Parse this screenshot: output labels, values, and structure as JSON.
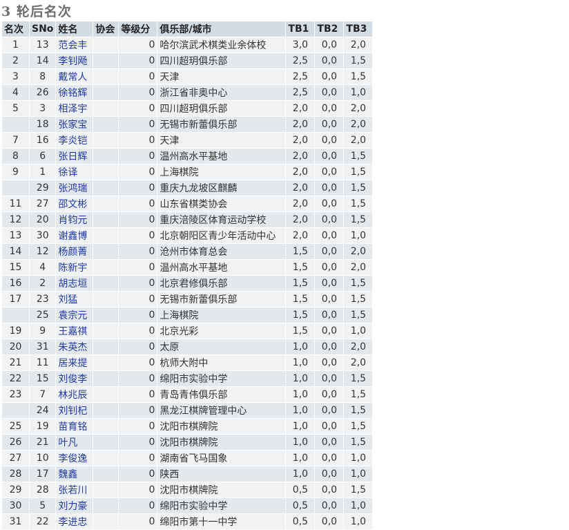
{
  "title": "3 轮后名次",
  "headers": {
    "rank": "名次",
    "sno": "SNo",
    "name": "姓名",
    "fed": "协会",
    "rating": "等级分",
    "club": "俱乐部/城市",
    "tb1": "TB1",
    "tb2": "TB2",
    "tb3": "TB3"
  },
  "rows": [
    {
      "rank": "1",
      "sno": "13",
      "name": "范会丰",
      "fed": "",
      "rating": "0",
      "club": "哈尔滨武术棋类业余体校",
      "tb1": "3,0",
      "tb2": "0,0",
      "tb3": "2,0"
    },
    {
      "rank": "2",
      "sno": "14",
      "name": "李钊飏",
      "fed": "",
      "rating": "0",
      "club": "四川超玥俱乐部",
      "tb1": "2,5",
      "tb2": "0,0",
      "tb3": "1,5"
    },
    {
      "rank": "3",
      "sno": "8",
      "name": "戴常人",
      "fed": "",
      "rating": "0",
      "club": "天津",
      "tb1": "2,5",
      "tb2": "0,0",
      "tb3": "1,5"
    },
    {
      "rank": "4",
      "sno": "26",
      "name": "徐铭辉",
      "fed": "",
      "rating": "0",
      "club": "浙江省非奥中心",
      "tb1": "2,5",
      "tb2": "0,0",
      "tb3": "1,0"
    },
    {
      "rank": "5",
      "sno": "3",
      "name": "相泽宇",
      "fed": "",
      "rating": "0",
      "club": "四川超玥俱乐部",
      "tb1": "2,0",
      "tb2": "0,0",
      "tb3": "2,0"
    },
    {
      "rank": "",
      "sno": "18",
      "name": "张家宝",
      "fed": "",
      "rating": "0",
      "club": "无锡市新蕾俱乐部",
      "tb1": "2,0",
      "tb2": "0,0",
      "tb3": "2,0"
    },
    {
      "rank": "7",
      "sno": "16",
      "name": "李炎铠",
      "fed": "",
      "rating": "0",
      "club": "天津",
      "tb1": "2,0",
      "tb2": "0,0",
      "tb3": "2,0"
    },
    {
      "rank": "8",
      "sno": "6",
      "name": "张日辉",
      "fed": "",
      "rating": "0",
      "club": "温州高水平基地",
      "tb1": "2,0",
      "tb2": "0,0",
      "tb3": "1,5"
    },
    {
      "rank": "9",
      "sno": "1",
      "name": "徐译",
      "fed": "",
      "rating": "0",
      "club": "上海棋院",
      "tb1": "2,0",
      "tb2": "0,0",
      "tb3": "1,5"
    },
    {
      "rank": "",
      "sno": "29",
      "name": "张鸿瑞",
      "fed": "",
      "rating": "0",
      "club": "重庆九龙坡区麒麟",
      "tb1": "2,0",
      "tb2": "0,0",
      "tb3": "1,5"
    },
    {
      "rank": "11",
      "sno": "27",
      "name": "邵文彬",
      "fed": "",
      "rating": "0",
      "club": "山东省棋类协会",
      "tb1": "2,0",
      "tb2": "0,0",
      "tb3": "1,5"
    },
    {
      "rank": "12",
      "sno": "20",
      "name": "肖钧元",
      "fed": "",
      "rating": "0",
      "club": "重庆涪陵区体育运动学校",
      "tb1": "2,0",
      "tb2": "0,0",
      "tb3": "1,5"
    },
    {
      "rank": "13",
      "sno": "30",
      "name": "谢鑫博",
      "fed": "",
      "rating": "0",
      "club": "北京朝阳区青少年活动中心",
      "tb1": "2,0",
      "tb2": "0,0",
      "tb3": "1,0"
    },
    {
      "rank": "14",
      "sno": "12",
      "name": "杨颜菁",
      "fed": "",
      "rating": "0",
      "club": "沧州市体育总会",
      "tb1": "1,5",
      "tb2": "0,0",
      "tb3": "2,0"
    },
    {
      "rank": "15",
      "sno": "4",
      "name": "陈新宇",
      "fed": "",
      "rating": "0",
      "club": "温州高水平基地",
      "tb1": "1,5",
      "tb2": "0,0",
      "tb3": "2,0"
    },
    {
      "rank": "16",
      "sno": "2",
      "name": "胡志垣",
      "fed": "",
      "rating": "0",
      "club": "北京君修俱乐部",
      "tb1": "1,5",
      "tb2": "0,0",
      "tb3": "1,5"
    },
    {
      "rank": "17",
      "sno": "23",
      "name": "刘猛",
      "fed": "",
      "rating": "0",
      "club": "无锡市新蕾俱乐部",
      "tb1": "1,5",
      "tb2": "0,0",
      "tb3": "1,5"
    },
    {
      "rank": "",
      "sno": "25",
      "name": "袁宗元",
      "fed": "",
      "rating": "0",
      "club": "上海棋院",
      "tb1": "1,5",
      "tb2": "0,0",
      "tb3": "1,5"
    },
    {
      "rank": "19",
      "sno": "9",
      "name": "王嘉祺",
      "fed": "",
      "rating": "0",
      "club": "北京光彩",
      "tb1": "1,5",
      "tb2": "0,0",
      "tb3": "1,0"
    },
    {
      "rank": "20",
      "sno": "31",
      "name": "朱英杰",
      "fed": "",
      "rating": "0",
      "club": "太原",
      "tb1": "1,0",
      "tb2": "0,0",
      "tb3": "2,0"
    },
    {
      "rank": "21",
      "sno": "11",
      "name": "居来提",
      "fed": "",
      "rating": "0",
      "club": "杭师大附中",
      "tb1": "1,0",
      "tb2": "0,0",
      "tb3": "2,0"
    },
    {
      "rank": "22",
      "sno": "15",
      "name": "刘俊李",
      "fed": "",
      "rating": "0",
      "club": "绵阳市实验中学",
      "tb1": "1,0",
      "tb2": "0,0",
      "tb3": "1,5"
    },
    {
      "rank": "23",
      "sno": "7",
      "name": "林兆辰",
      "fed": "",
      "rating": "0",
      "club": "青岛青伟俱乐部",
      "tb1": "1,0",
      "tb2": "0,0",
      "tb3": "1,5"
    },
    {
      "rank": "",
      "sno": "24",
      "name": "刘钊杞",
      "fed": "",
      "rating": "0",
      "club": "黑龙江棋牌管理中心",
      "tb1": "1,0",
      "tb2": "0,0",
      "tb3": "1,5"
    },
    {
      "rank": "25",
      "sno": "19",
      "name": "苗育铭",
      "fed": "",
      "rating": "0",
      "club": "沈阳市棋牌院",
      "tb1": "1,0",
      "tb2": "0,0",
      "tb3": "1,5"
    },
    {
      "rank": "26",
      "sno": "21",
      "name": "叶凡",
      "fed": "",
      "rating": "0",
      "club": "沈阳市棋牌院",
      "tb1": "1,0",
      "tb2": "0,0",
      "tb3": "1,5"
    },
    {
      "rank": "27",
      "sno": "10",
      "name": "李俊逸",
      "fed": "",
      "rating": "0",
      "club": "湖南省飞马国象",
      "tb1": "1,0",
      "tb2": "0,0",
      "tb3": "1,0"
    },
    {
      "rank": "28",
      "sno": "17",
      "name": "魏鑫",
      "fed": "",
      "rating": "0",
      "club": "陕西",
      "tb1": "1,0",
      "tb2": "0,0",
      "tb3": "1,0"
    },
    {
      "rank": "29",
      "sno": "28",
      "name": "张若川",
      "fed": "",
      "rating": "0",
      "club": "沈阳市棋牌院",
      "tb1": "0,5",
      "tb2": "0,0",
      "tb3": "1,5"
    },
    {
      "rank": "30",
      "sno": "5",
      "name": "刘力豪",
      "fed": "",
      "rating": "0",
      "club": "绵阳市实验中学",
      "tb1": "0,5",
      "tb2": "0,0",
      "tb3": "1,0"
    },
    {
      "rank": "31",
      "sno": "22",
      "name": "李进忠",
      "fed": "",
      "rating": "0",
      "club": "绵阳市第十一中学",
      "tb1": "0,5",
      "tb2": "0,0",
      "tb3": "1,0"
    }
  ]
}
